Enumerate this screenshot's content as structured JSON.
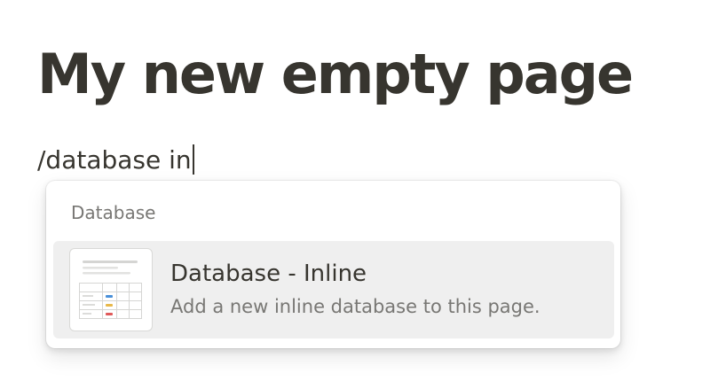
{
  "page": {
    "title": "My new empty page"
  },
  "editor": {
    "command_text": "/database in"
  },
  "menu": {
    "section_label": "Database",
    "items": [
      {
        "title": "Database - Inline",
        "description": "Add a new inline database to this page.",
        "icon": "inline-database-thumbnail-icon",
        "highlighted": true
      }
    ]
  },
  "colors": {
    "text": "#37352f",
    "secondary_text": "#787774",
    "highlight_bg": "#efefef",
    "thumb_blue": "#4a90d9",
    "thumb_yellow": "#e8b84a",
    "thumb_red": "#e05a5a"
  }
}
